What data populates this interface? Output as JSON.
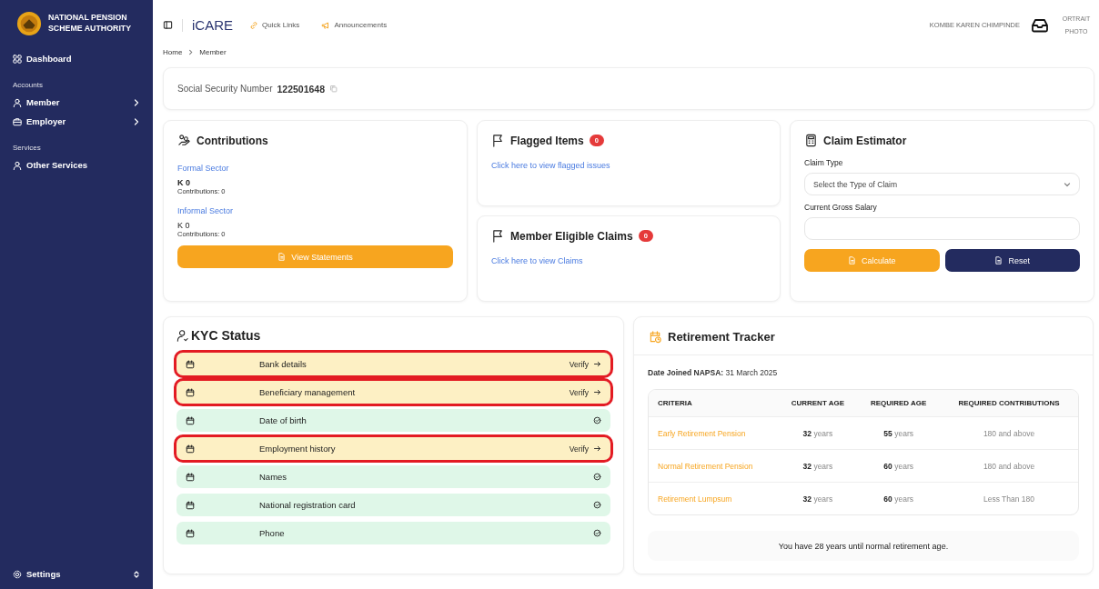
{
  "sidebar": {
    "org_name": "NATIONAL PENSION SCHEME AUTHORITY",
    "top_items": [
      {
        "label": "Dashboard",
        "has_children": false
      }
    ],
    "sections": [
      {
        "title": "Accounts",
        "items": [
          {
            "label": "Member",
            "has_children": true
          },
          {
            "label": "Employer",
            "has_children": true
          }
        ]
      },
      {
        "title": "Services",
        "items": [
          {
            "label": "Other Services",
            "has_children": false
          }
        ]
      }
    ],
    "footer": {
      "label": "Settings"
    }
  },
  "topbar": {
    "app_name": "iCARE",
    "links": [
      {
        "label": "Quick Links"
      },
      {
        "label": "Announcements"
      }
    ],
    "user_name": "KOMBE KAREN CHIMPINDE",
    "portrait_alt": "ORTRAIT PHOTO"
  },
  "breadcrumb": [
    "Home",
    "Member"
  ],
  "ssn": {
    "label": "Social Security Number",
    "value": "122501648"
  },
  "contributions": {
    "title": "Contributions",
    "sectors": [
      {
        "name": "Formal Sector",
        "amount": "K 0",
        "amount_bold": true,
        "count": "Contributions: 0"
      },
      {
        "name": "Informal Sector",
        "amount": "K 0",
        "amount_bold": false,
        "count": "Contributions: 0"
      }
    ],
    "button": "View Statements"
  },
  "flagged_items": {
    "title": "Flagged Items",
    "badge": "0",
    "link": "Click here to view flagged issues"
  },
  "eligible_claims": {
    "title": "Member Eligible Claims",
    "badge": "0",
    "link": "Click here to view Claims"
  },
  "claim_estimator": {
    "title": "Claim Estimator",
    "claim_type_label": "Claim Type",
    "claim_type_placeholder": "Select the Type of Claim",
    "salary_label": "Current Gross Salary",
    "buttons": [
      {
        "label": "Calculate",
        "kind": "primary"
      },
      {
        "label": "Reset",
        "kind": "secondary"
      }
    ]
  },
  "kyc": {
    "title": "KYC Status",
    "items": [
      {
        "label": "Bank details",
        "verified": false,
        "action": "Verify"
      },
      {
        "label": "Beneficiary management",
        "verified": false,
        "action": "Verify"
      },
      {
        "label": "Date of birth",
        "verified": true
      },
      {
        "label": "Employment history",
        "verified": false,
        "action": "Verify"
      },
      {
        "label": "Names",
        "verified": true
      },
      {
        "label": "National registration card",
        "verified": true
      },
      {
        "label": "Phone",
        "verified": true
      }
    ]
  },
  "retirement_tracker": {
    "title": "Retirement Tracker",
    "date_joined_label": "Date Joined NAPSA:",
    "date_joined": "31 March 2025",
    "columns": [
      "CRITERIA",
      "CURRENT AGE",
      "REQUIRED AGE",
      "REQUIRED CONTRIBUTIONS"
    ],
    "rows": [
      [
        "Early Retirement Pension",
        "**32** years",
        "**55** years",
        "180 and above"
      ],
      [
        "Normal Retirement Pension",
        "**32** years",
        "**60** years",
        "180 and above"
      ],
      [
        "Retirement Lumpsum",
        "**32** years",
        "**60** years",
        "Less Than 180"
      ]
    ],
    "note": "You have 28 years until normal retirement age."
  }
}
